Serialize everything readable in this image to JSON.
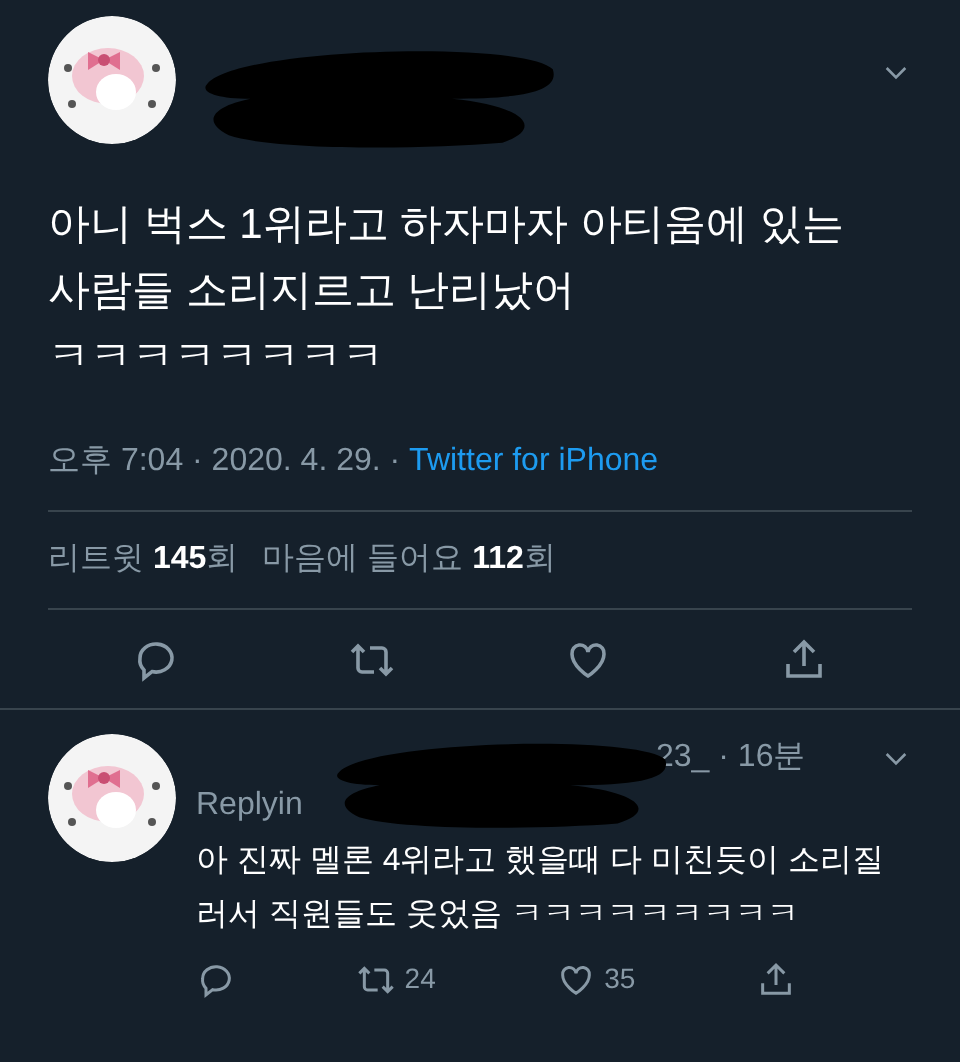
{
  "tweet": {
    "text": "아니 벅스 1위라고 하자마자 아티움에 있는 사람들 소리지르고 난리났어 ㅋㅋㅋㅋㅋㅋㅋㅋ",
    "time": "오후 7:04 · 2020. 4. 29. · ",
    "source": "Twitter for iPhone",
    "stats": [
      {
        "label": "리트윗",
        "count": "145",
        "unit": "회"
      },
      {
        "label": "마음에 들어요",
        "count": "112",
        "unit": "회"
      }
    ]
  },
  "reply": {
    "handle_tail": "23_ · 16분",
    "replying": "Replyin",
    "text": "아 진짜 멜론 4위라고 했을때 다 미친듯이 소리질러서 직원들도 웃었음 ㅋㅋㅋㅋㅋㅋㅋㅋㅋ",
    "retweets": "24",
    "likes": "35"
  }
}
